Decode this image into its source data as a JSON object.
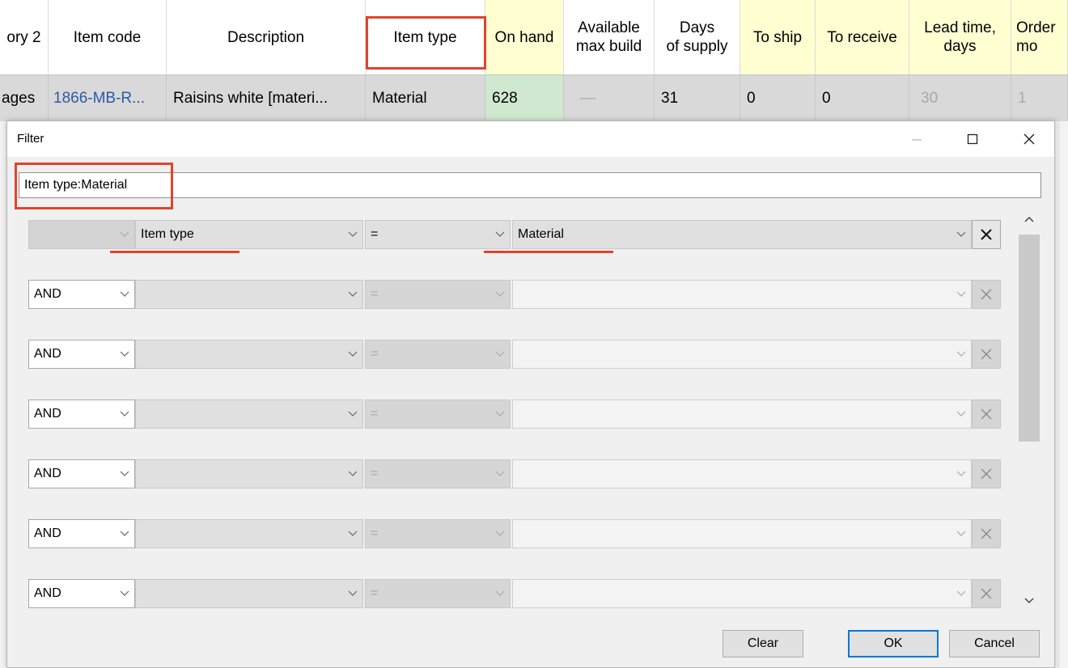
{
  "grid": {
    "headers": [
      {
        "label": "ory 2",
        "bg": "plain"
      },
      {
        "label": "Item code",
        "bg": "plain"
      },
      {
        "label": "Description",
        "bg": "plain"
      },
      {
        "label": "Item type",
        "bg": "plain"
      },
      {
        "label": "On hand",
        "bg": "yellow"
      },
      {
        "label": "Available\nmax build",
        "bg": "plain"
      },
      {
        "label": "Days\nof supply",
        "bg": "plain"
      },
      {
        "label": "To ship",
        "bg": "yellow"
      },
      {
        "label": "To receive",
        "bg": "yellow"
      },
      {
        "label": "Lead time,\ndays",
        "bg": "yellow"
      },
      {
        "label": "Order\nmo",
        "bg": "yellow"
      }
    ],
    "row": [
      {
        "value": "ages",
        "style": ""
      },
      {
        "value": "1866-MB-R...",
        "style": "link"
      },
      {
        "value": "Raisins white [materi...",
        "style": ""
      },
      {
        "value": "Material",
        "style": ""
      },
      {
        "value": "628",
        "style": "green"
      },
      {
        "value": "—",
        "style": "dim"
      },
      {
        "value": "31",
        "style": ""
      },
      {
        "value": "0",
        "style": ""
      },
      {
        "value": "0",
        "style": ""
      },
      {
        "value": "30",
        "style": "dim"
      },
      {
        "value": "1",
        "style": "dim"
      }
    ]
  },
  "dialog": {
    "title": "Filter",
    "expression": "Item type:Material",
    "rows": [
      {
        "logic": "",
        "field": "Item type",
        "operator": "=",
        "value": "Material",
        "active": true
      },
      {
        "logic": "AND",
        "field": "",
        "operator": "=",
        "value": "",
        "active": false
      },
      {
        "logic": "AND",
        "field": "",
        "operator": "=",
        "value": "",
        "active": false
      },
      {
        "logic": "AND",
        "field": "",
        "operator": "=",
        "value": "",
        "active": false
      },
      {
        "logic": "AND",
        "field": "",
        "operator": "=",
        "value": "",
        "active": false
      },
      {
        "logic": "AND",
        "field": "",
        "operator": "=",
        "value": "",
        "active": false
      },
      {
        "logic": "AND",
        "field": "",
        "operator": "=",
        "value": "",
        "active": false
      }
    ],
    "buttons": {
      "clear": "Clear",
      "ok": "OK",
      "cancel": "Cancel"
    }
  },
  "colors": {
    "highlight": "#e0442e",
    "header_yellow": "#ffffd2",
    "on_hand_green": "#cfe8cf",
    "link_blue": "#2a5aa8",
    "ok_border": "#0078d7"
  }
}
